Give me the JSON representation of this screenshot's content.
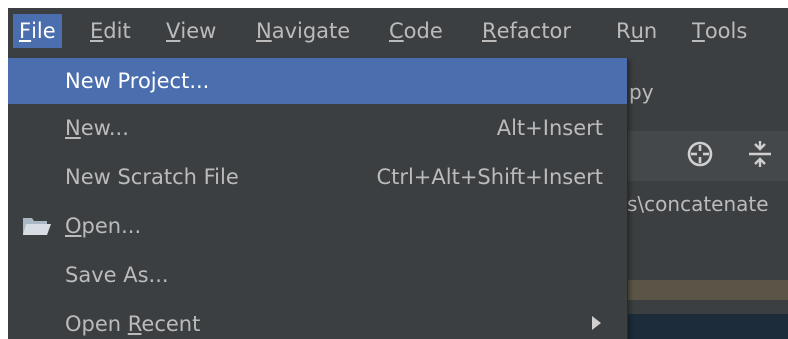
{
  "menubar": {
    "items": [
      {
        "label": "File",
        "underline_index": 0
      },
      {
        "label": "Edit",
        "underline_index": 0
      },
      {
        "label": "View",
        "underline_index": 0
      },
      {
        "label": "Navigate",
        "underline_index": 0
      },
      {
        "label": "Code",
        "underline_index": 0
      },
      {
        "label": "Refactor",
        "underline_index": 0
      },
      {
        "label": "Run",
        "underline_index": 1
      },
      {
        "label": "Tools",
        "underline_index": 0
      }
    ]
  },
  "background": {
    "tab_fragment": "py",
    "path_fragment": "s\\concatenate"
  },
  "file_menu": {
    "items": [
      {
        "label": "New Project...",
        "underline_index": -1,
        "shortcut": "",
        "selected": true,
        "icon": ""
      },
      {
        "label": "New...",
        "underline_index": 0,
        "shortcut": "Alt+Insert",
        "selected": false,
        "icon": ""
      },
      {
        "label": "New Scratch File",
        "underline_index": -1,
        "shortcut": "Ctrl+Alt+Shift+Insert",
        "selected": false,
        "icon": ""
      },
      {
        "label": "Open...",
        "underline_index": 0,
        "shortcut": "",
        "selected": false,
        "icon": "folder-open-icon"
      },
      {
        "label": "Save As...",
        "underline_index": -1,
        "shortcut": "",
        "selected": false,
        "icon": ""
      },
      {
        "label": "Open Recent",
        "underline_index": 5,
        "shortcut": "",
        "selected": false,
        "icon": "",
        "submenu": true
      }
    ]
  },
  "colors": {
    "menu_bg": "#3c3f41",
    "selection": "#4b6eaf",
    "text": "#bbbbbb"
  }
}
